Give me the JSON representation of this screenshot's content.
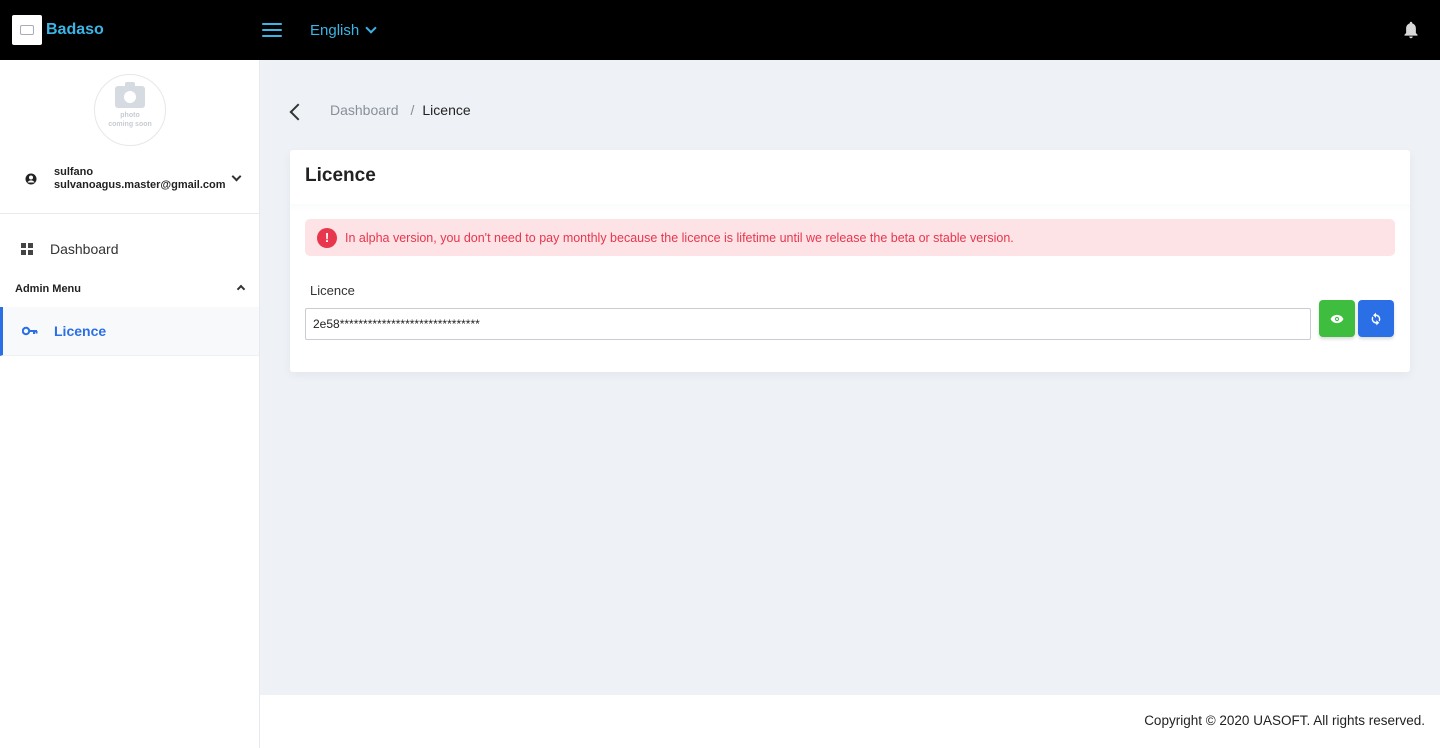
{
  "topbar": {
    "brand": "Badaso",
    "language": "English",
    "colors": {
      "background": "#000000",
      "accent": "#3bb5e6"
    }
  },
  "sidebar": {
    "avatar_text": [
      "photo",
      "coming soon"
    ],
    "user": {
      "name": "sulfano",
      "email": "sulvanoagus.master@gmail.com"
    },
    "items": [
      {
        "label": "Dashboard",
        "icon": "dashboard-icon"
      }
    ],
    "admin_menu": {
      "label": "Admin Menu",
      "items": [
        {
          "label": "Licence",
          "icon": "key-icon",
          "active": true
        }
      ]
    }
  },
  "breadcrumb": {
    "items": [
      "Dashboard",
      "Licence"
    ],
    "separator": "/"
  },
  "card": {
    "title": "Licence",
    "alert": "In alpha version, you don't need to pay monthly because the licence is lifetime until we release the beta or stable version.",
    "field_label": "Licence",
    "licence_value": "2e58******************************",
    "buttons": [
      {
        "icon": "eye-icon",
        "color": "#3fbd3f"
      },
      {
        "icon": "refresh-icon",
        "color": "#2a6fe6"
      }
    ]
  },
  "footer": {
    "text": "Copyright © 2020 UASOFT. All rights reserved."
  }
}
